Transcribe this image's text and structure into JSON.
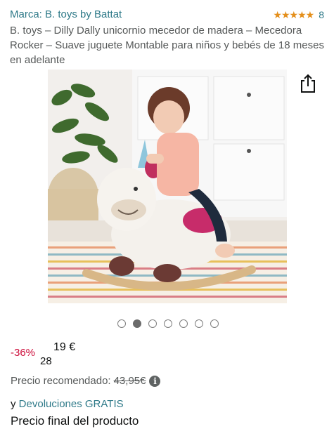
{
  "brand": {
    "label": "Marca: B. toys by Battat"
  },
  "rating": {
    "stars": 5,
    "count": "8",
    "star_color": "#e48f1b"
  },
  "title": "B. toys – Dilly Dally unicornio mecedor de madera – Mecedora Rocker – Suave juguete Montable para niños y bebés de 18 meses en adelante",
  "image": {
    "alt": "Niña sentada en un unicornio mecedor de madera de peluche blanco"
  },
  "share": {
    "icon": "share-icon"
  },
  "carousel": {
    "total": 7,
    "active_index": 1
  },
  "price": {
    "discount": "-36%",
    "whole": "19 €",
    "fraction": "28"
  },
  "recommended": {
    "label": "Precio recomendado:",
    "price": "43,95€",
    "info_icon": "info-icon"
  },
  "returns": {
    "prefix": "y ",
    "link": "Devoluciones GRATIS"
  },
  "final_price_label": "Precio final del producto",
  "colors": {
    "link": "#2f7a89",
    "discount": "#cc0c39",
    "text": "#0f1111",
    "muted": "#565959"
  }
}
